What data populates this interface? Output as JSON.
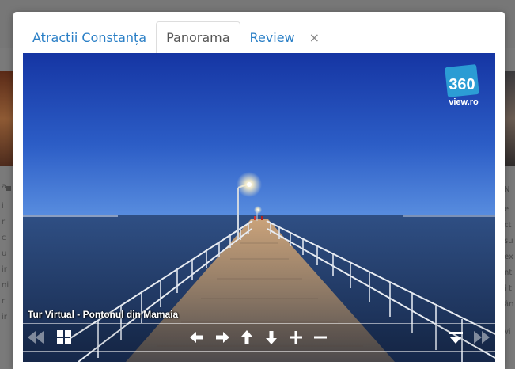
{
  "tabs": [
    {
      "label": "Atractii Constanța",
      "active": false
    },
    {
      "label": "Panorama",
      "active": true
    },
    {
      "label": "Review",
      "active": false
    }
  ],
  "close_glyph": "×",
  "viewer": {
    "logo_text_top": "360",
    "logo_text_bottom": "view.ro",
    "tour_title": "Tur Virtual - Pontonul din Mamaia",
    "controls": [
      {
        "name": "rewind-left-icon"
      },
      {
        "name": "grid-icon"
      },
      {
        "name": "arrow-left-icon"
      },
      {
        "name": "arrow-right-icon"
      },
      {
        "name": "arrow-up-icon"
      },
      {
        "name": "arrow-down-icon"
      },
      {
        "name": "zoom-in-icon"
      },
      {
        "name": "zoom-out-icon"
      },
      {
        "name": "hide-controls-icon"
      },
      {
        "name": "forward-right-icon"
      }
    ]
  },
  "background_page": {
    "right_letters": [
      "N",
      "e",
      "ct",
      "șu",
      "ex",
      "nt",
      "i t",
      "ân",
      "vi"
    ],
    "left_letters": [
      "a",
      "i",
      "r",
      "c",
      "u",
      "ir",
      "ni",
      "r",
      "ir"
    ]
  },
  "colors": {
    "tab_link": "#2a7fc6",
    "tab_active": "#555555",
    "sky_top": "#1d3fa8",
    "sky_horizon": "#4a7fd2",
    "sea": "#1f3a67"
  }
}
